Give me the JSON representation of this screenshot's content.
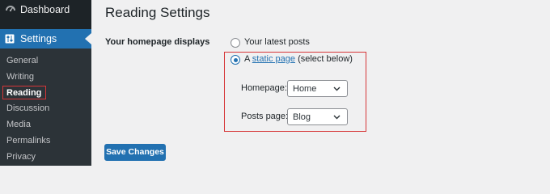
{
  "sidebar": {
    "dashboard_label": "Dashboard",
    "settings_label": "Settings",
    "submenu": [
      "General",
      "Writing",
      "Reading",
      "Discussion",
      "Media",
      "Permalinks",
      "Privacy"
    ],
    "current": "Reading"
  },
  "main": {
    "title": "Reading Settings",
    "homepage_displays_label": "Your homepage displays",
    "options": {
      "latest_posts": "Your latest posts",
      "static_prefix": "A",
      "static_link": "static page",
      "static_suffix": "(select below)"
    },
    "selected_option": "static_page",
    "homepage_label": "Homepage:",
    "homepage_value": "Home",
    "posts_page_label": "Posts page:",
    "posts_page_value": "Blog",
    "save_label": "Save Changes"
  },
  "colors": {
    "sidebar_bg": "#1d2327",
    "submenu_bg": "#2c3338",
    "accent": "#2271b1",
    "highlight": "#d63638",
    "page_bg": "#f0f0f1"
  },
  "icons": {
    "dashboard": "dashboard-icon",
    "settings": "settings-icon",
    "select_arrow": "chevron-down-icon"
  }
}
